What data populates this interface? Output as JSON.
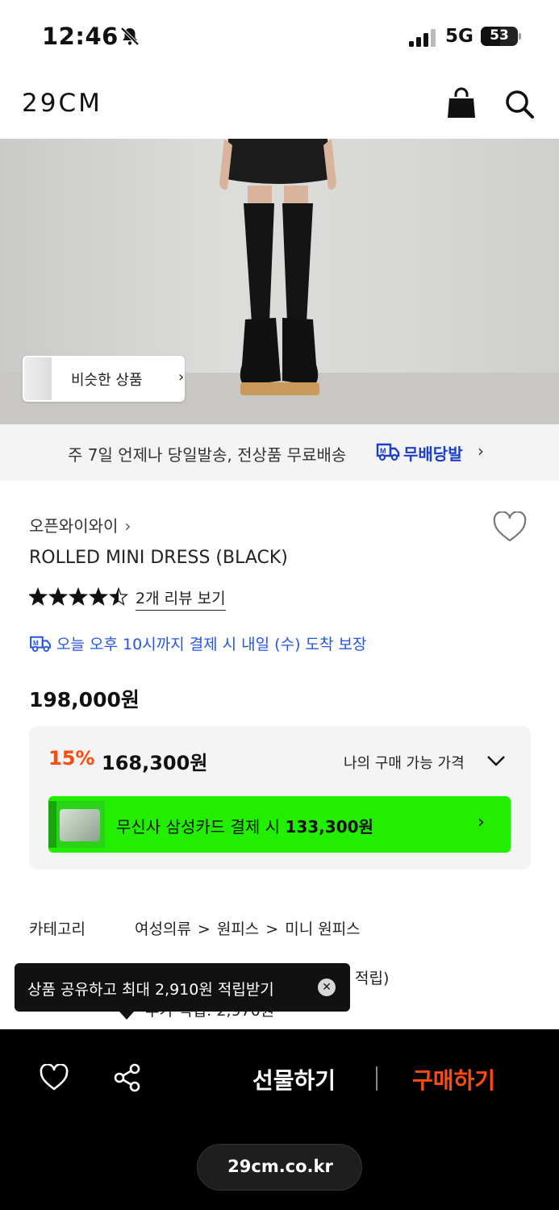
{
  "status_bar": {
    "time": "12:46",
    "network": "5G",
    "battery": "53",
    "battery_level": 0.53
  },
  "header": {
    "logo": "29CM",
    "icons": [
      "shopping-bag-icon",
      "search-icon"
    ]
  },
  "hero": {
    "similar_button_label": "비슷한 상품",
    "similar_chevron": "›"
  },
  "shipping_banner": {
    "text": "주 7일 언제나 당일발송, 전상품 무료배송",
    "brand": "무배당발",
    "chevron": "›"
  },
  "product": {
    "brand": "오픈와이와이",
    "brand_chevron": "›",
    "name": "ROLLED MINI DRESS (BLACK)",
    "rating": 4.5,
    "review_link": "2개 리뷰 보기",
    "delivery_notice": "오늘 오후 10시까지 결제 시 내일 (수) 도착 보장",
    "original_price": "198,000원"
  },
  "price_box": {
    "discount": "15%",
    "sale_price": "168,300원",
    "my_price_label": "나의 구매 가능 가격",
    "promo_text_prefix": "무신사 삼성카드 결제 시 ",
    "promo_price": "133,300원",
    "promo_color": "#22ee00"
  },
  "category": {
    "label": "카테고리",
    "path": [
      "여성의류",
      "원피스",
      "미니 원피스"
    ],
    "separator": ">"
  },
  "points": {
    "line1": "적립)",
    "line2": "추가 적립: 2,970원"
  },
  "tooltip": {
    "text": "상품 공유하고 최대 2,910원 적립받기",
    "close": "✕"
  },
  "bottom_bar": {
    "gift_label": "선물하기",
    "buy_label": "구매하기",
    "url": "29cm.co.kr",
    "accent": "#ff4b10"
  }
}
